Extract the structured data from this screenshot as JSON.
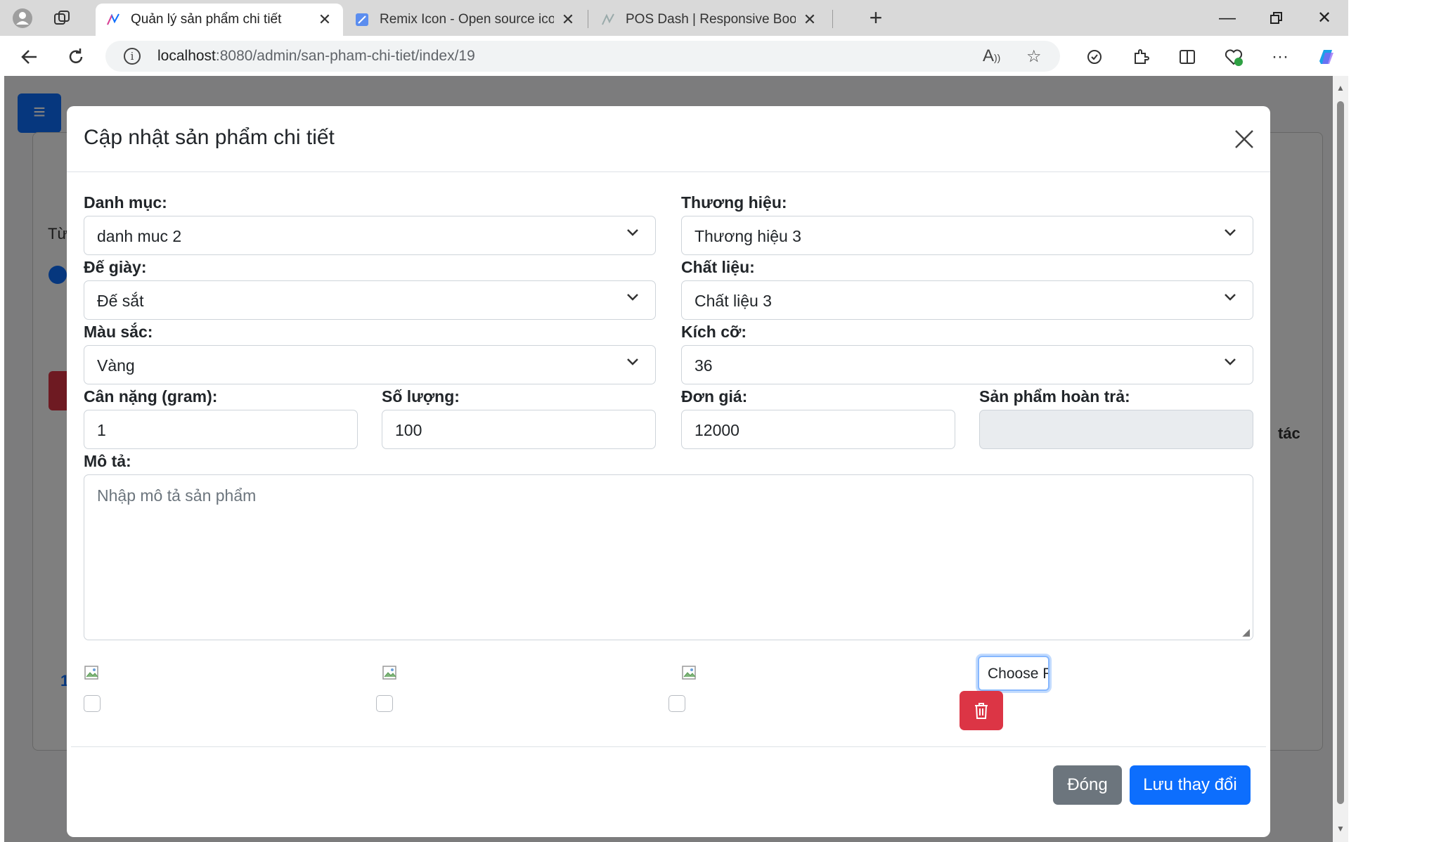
{
  "browser": {
    "tabs": [
      {
        "label": "Quản lý sản phẩm chi tiết",
        "active": true
      },
      {
        "label": "Remix Icon - Open source icon lib",
        "active": false
      },
      {
        "label": "POS Dash | Responsive Bootstrap",
        "active": false
      }
    ],
    "url_host": "localhost",
    "url_path": ":8080/admin/san-pham-chi-tiet/index/19"
  },
  "background": {
    "frag_tu": "Từ",
    "frag_tac": "tác",
    "frag_1": "1"
  },
  "modal": {
    "title": "Cập nhật sản phẩm chi tiết",
    "fields": {
      "danh_muc": {
        "label": "Danh mục:",
        "value": "danh muc 2"
      },
      "thuong_hieu": {
        "label": "Thương hiệu:",
        "value": "Thương hiệu 3"
      },
      "de_giay": {
        "label": "Đế giày:",
        "value": "Đế sắt"
      },
      "chat_lieu": {
        "label": "Chất liệu:",
        "value": "Chất liệu 3"
      },
      "mau_sac": {
        "label": "Màu sắc:",
        "value": "Vàng"
      },
      "kich_co": {
        "label": "Kích cỡ:",
        "value": "36"
      },
      "can_nang": {
        "label": "Cân nặng (gram):",
        "value": "1"
      },
      "so_luong": {
        "label": "Số lượng:",
        "value": "100"
      },
      "don_gia": {
        "label": "Đơn giá:",
        "value": "12000"
      },
      "hoan_tra": {
        "label": "Sản phẩm hoàn trả:",
        "value": ""
      },
      "mo_ta": {
        "label": "Mô tả:",
        "placeholder": "Nhập mô tả sản phẩm"
      }
    },
    "choose_file_label": "Choose F",
    "buttons": {
      "close": "Đóng",
      "save": "Lưu thay đổi"
    }
  },
  "colors": {
    "primary": "#0d6efd",
    "secondary": "#6c757d",
    "danger": "#dc3545"
  }
}
